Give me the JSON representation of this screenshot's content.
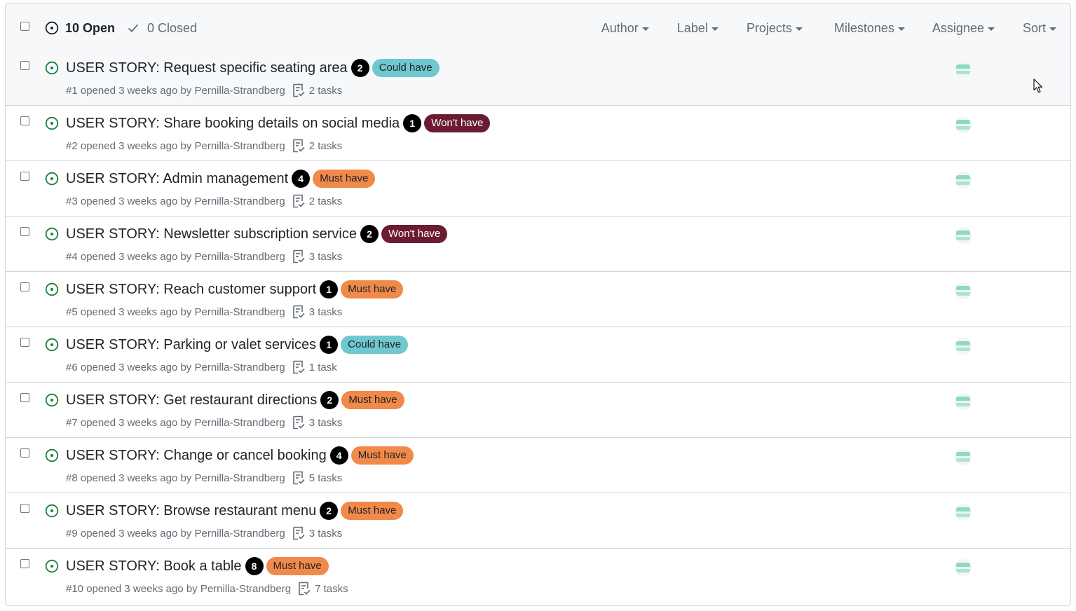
{
  "header": {
    "open_label": "10 Open",
    "closed_label": "0 Closed",
    "filters": [
      "Author",
      "Label",
      "Projects",
      "Milestones",
      "Assignee",
      "Sort"
    ]
  },
  "colors": {
    "open_icon": "#1a7f37",
    "could_have": "#6fc7cf",
    "wont_have": "#6b1b32",
    "must_have": "#f0894a"
  },
  "issues": [
    {
      "title": "USER STORY: Request specific seating area",
      "count": "2",
      "label": "Could have",
      "label_type": "could",
      "number": "#1",
      "opened": "opened 3 weeks ago by",
      "author": "Pernilla-Strandberg",
      "tasks": "2 tasks"
    },
    {
      "title": "USER STORY: Share booking details on social media",
      "count": "1",
      "label": "Won't have",
      "label_type": "wont",
      "number": "#2",
      "opened": "opened 3 weeks ago by",
      "author": "Pernilla-Strandberg",
      "tasks": "2 tasks"
    },
    {
      "title": "USER STORY: Admin management",
      "count": "4",
      "label": "Must have",
      "label_type": "must",
      "number": "#3",
      "opened": "opened 3 weeks ago by",
      "author": "Pernilla-Strandberg",
      "tasks": "2 tasks"
    },
    {
      "title": "USER STORY: Newsletter subscription service",
      "count": "2",
      "label": "Won't have",
      "label_type": "wont",
      "number": "#4",
      "opened": "opened 3 weeks ago by",
      "author": "Pernilla-Strandberg",
      "tasks": "3 tasks"
    },
    {
      "title": "USER STORY: Reach customer support",
      "count": "1",
      "label": "Must have",
      "label_type": "must",
      "number": "#5",
      "opened": "opened 3 weeks ago by",
      "author": "Pernilla-Strandberg",
      "tasks": "3 tasks"
    },
    {
      "title": "USER STORY: Parking or valet services",
      "count": "1",
      "label": "Could have",
      "label_type": "could",
      "number": "#6",
      "opened": "opened 3 weeks ago by",
      "author": "Pernilla-Strandberg",
      "tasks": "1 task"
    },
    {
      "title": "USER STORY: Get restaurant directions",
      "count": "2",
      "label": "Must have",
      "label_type": "must",
      "number": "#7",
      "opened": "opened 3 weeks ago by",
      "author": "Pernilla-Strandberg",
      "tasks": "3 tasks"
    },
    {
      "title": "USER STORY: Change or cancel booking",
      "count": "4",
      "label": "Must have",
      "label_type": "must",
      "number": "#8",
      "opened": "opened 3 weeks ago by",
      "author": "Pernilla-Strandberg",
      "tasks": "5 tasks"
    },
    {
      "title": "USER STORY: Browse restaurant menu",
      "count": "2",
      "label": "Must have",
      "label_type": "must",
      "number": "#9",
      "opened": "opened 3 weeks ago by",
      "author": "Pernilla-Strandberg",
      "tasks": "3 tasks"
    },
    {
      "title": "USER STORY: Book a table",
      "count": "8",
      "label": "Must have",
      "label_type": "must",
      "number": "#10",
      "opened": "opened 3 weeks ago by",
      "author": "Pernilla-Strandberg",
      "tasks": "7 tasks"
    }
  ]
}
